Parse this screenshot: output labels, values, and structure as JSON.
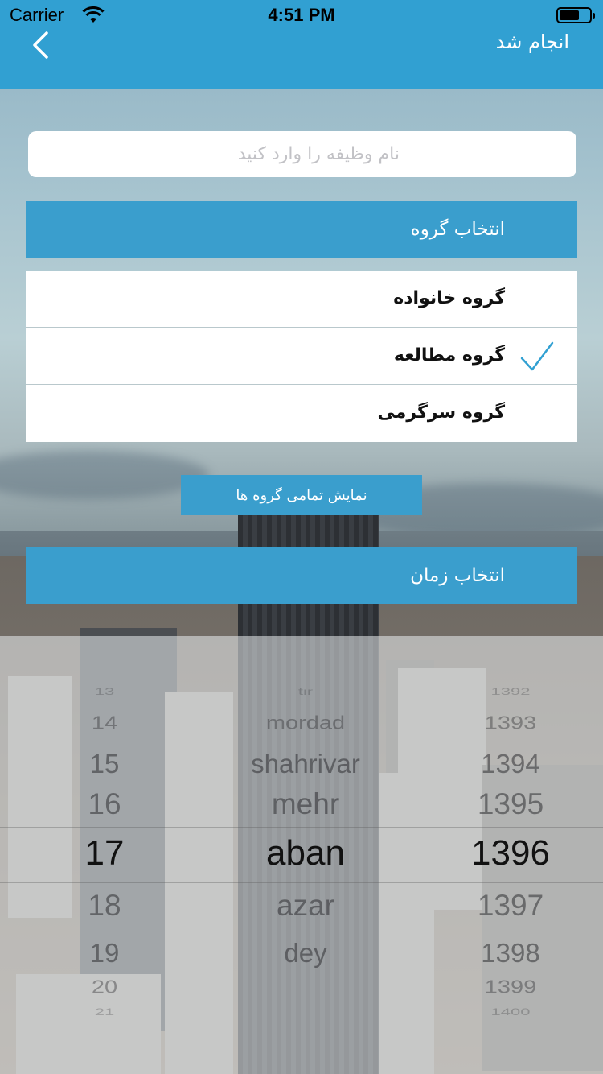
{
  "status_bar": {
    "carrier": "Carrier",
    "time": "4:51 PM"
  },
  "nav": {
    "done_label": "انجام شد",
    "back_icon": "chevron-left-icon"
  },
  "task": {
    "placeholder": "نام وظیفه را وارد کنید",
    "value": ""
  },
  "group_section": {
    "title": "انتخاب گروه",
    "items": [
      {
        "label": "گروه خانواده",
        "checked": false
      },
      {
        "label": "گروه مطالعه",
        "checked": true
      },
      {
        "label": "گروه سرگرمی",
        "checked": false
      }
    ],
    "show_all_label": "نمایش تمامی گروه ها"
  },
  "time_section": {
    "title": "انتخاب زمان"
  },
  "date_picker": {
    "days": [
      "13",
      "14",
      "15",
      "16",
      "17",
      "18",
      "19",
      "20",
      "21"
    ],
    "months": [
      "tir",
      "mordad",
      "shahrivar",
      "mehr",
      "aban",
      "azar",
      "dey"
    ],
    "years": [
      "1392",
      "1393",
      "1394",
      "1395",
      "1396",
      "1397",
      "1398",
      "1399",
      "1400"
    ],
    "selected": {
      "day": "17",
      "month": "aban",
      "year": "1396"
    }
  },
  "colors": {
    "nav_bar": "#31a0d2",
    "section_header": "#3a9ecd",
    "check": "#31a0d2"
  }
}
